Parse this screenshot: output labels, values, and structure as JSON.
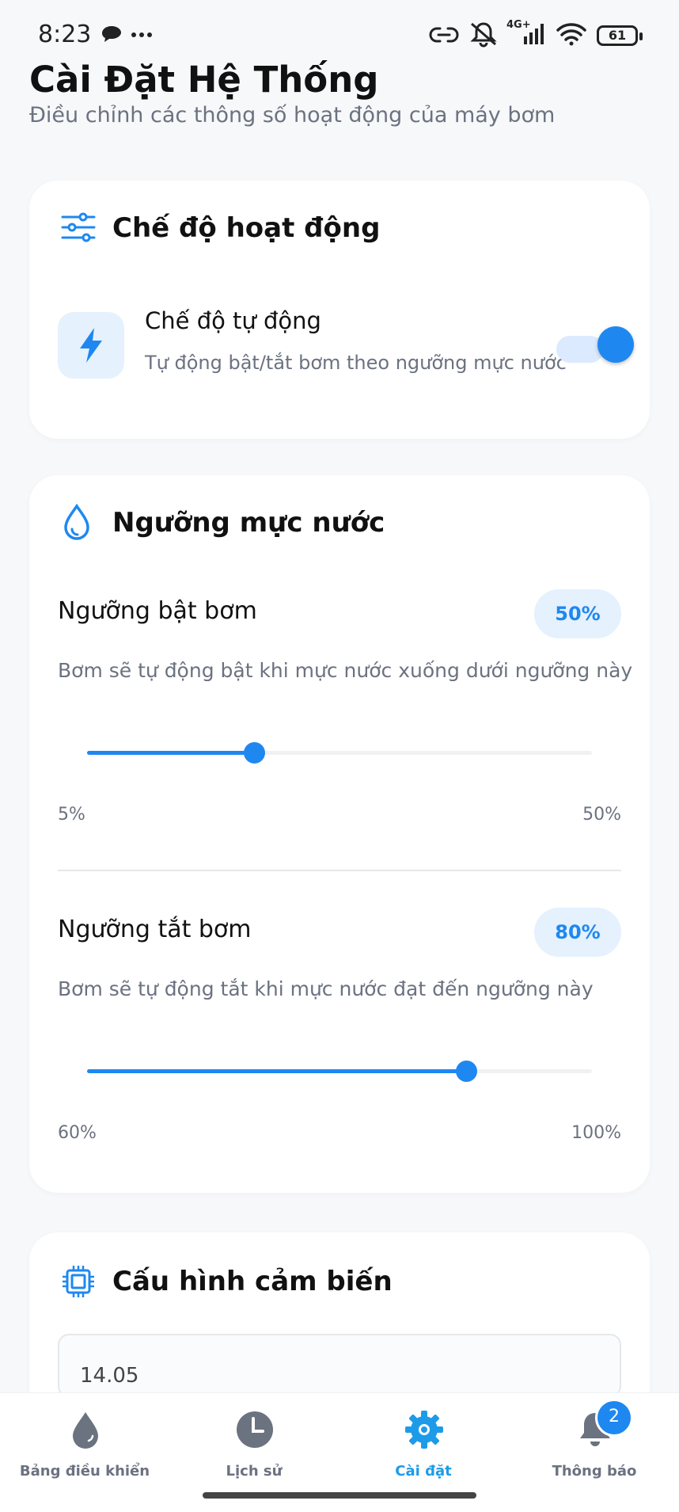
{
  "status_bar": {
    "time": "8:23",
    "network": "4G+",
    "battery": "61"
  },
  "header": {
    "title": "Cài Đặt Hệ Thống",
    "subtitle": "Điều chỉnh các thông số hoạt động của máy bơm"
  },
  "mode_card": {
    "title": "Chế độ hoạt động",
    "auto_mode": {
      "label": "Chế độ tự động",
      "description": "Tự động bật/tắt bơm theo ngưỡng mực nước",
      "enabled": true
    }
  },
  "threshold_card": {
    "title": "Ngưỡng mực nước",
    "pump_on": {
      "label": "Ngưỡng bật bơm",
      "value_label": "50%",
      "description": "Bơm sẽ tự động bật khi mực nước xuống dưới ngưỡng này",
      "min_label": "5%",
      "max_label": "50%",
      "slider_fraction": 0.33
    },
    "pump_off": {
      "label": "Ngưỡng tắt bơm",
      "value_label": "80%",
      "description": "Bơm sẽ tự động tắt khi mực nước đạt đến ngưỡng này",
      "min_label": "60%",
      "max_label": "100%",
      "slider_fraction": 0.75
    }
  },
  "sensor_card": {
    "title": "Cấu hình cảm biến",
    "field_value": "14.05"
  },
  "bottom_nav": {
    "items": [
      {
        "label": "Bảng điều khiển",
        "active": false
      },
      {
        "label": "Lịch sử",
        "active": false
      },
      {
        "label": "Cài đặt",
        "active": true
      },
      {
        "label": "Thông báo",
        "active": false
      }
    ],
    "notification_count": "2"
  },
  "colors": {
    "accent": "#1e88f0",
    "accent_light": "#e5f1fd",
    "nav_active": "#1e9be8",
    "nav_inactive": "#6b7280"
  }
}
